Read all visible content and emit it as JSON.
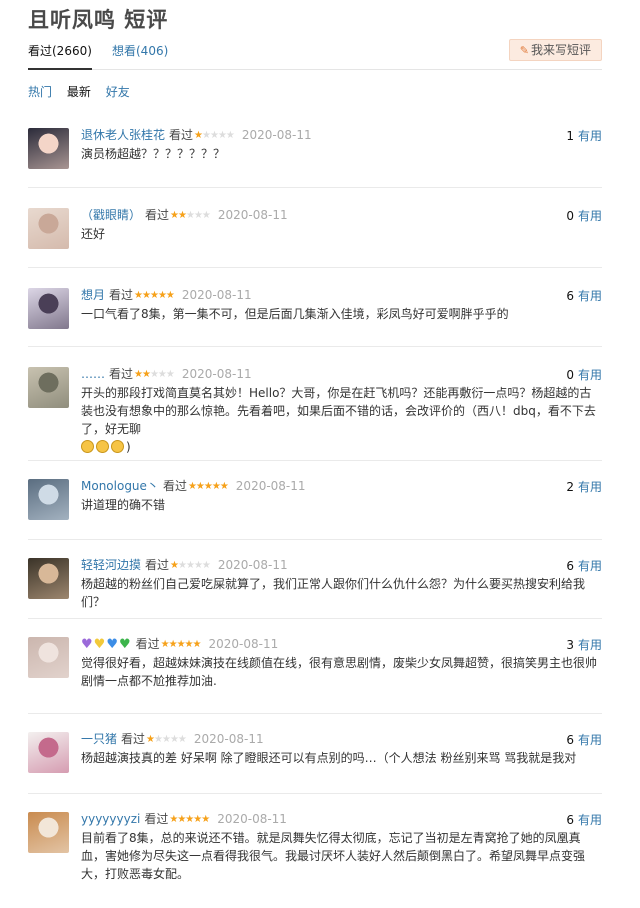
{
  "page": {
    "title": "且听凤鸣 短评"
  },
  "tabs": {
    "watched": "看过(2660)",
    "want": "想看(406)"
  },
  "write_button": "我来写短评",
  "filters": [
    "热门",
    "最新",
    "好友"
  ],
  "vote_label": "有用",
  "colors": {
    "link": "#3377aa",
    "star": "#f6a11a",
    "button_bg": "#fcebe0"
  },
  "comments": [
    {
      "user": "退休老人张桂花",
      "status": "看过",
      "rating": 1,
      "date": "2020-08-11",
      "votes": "1",
      "text": "演员杨超越？？？？？？？"
    },
    {
      "user": "（戳眼睛）",
      "status": "看过",
      "rating": 2,
      "date": "2020-08-11",
      "votes": "0",
      "text": "还好"
    },
    {
      "user": "想月",
      "status": "看过",
      "rating": 5,
      "date": "2020-08-11",
      "votes": "6",
      "text": "一口气看了8集，第一集不可，但是后面几集渐入佳境，彩凤鸟好可爱啊胖乎乎的"
    },
    {
      "user": "……",
      "status": "看过",
      "rating": 2,
      "date": "2020-08-11",
      "votes": "0",
      "text": "开头的那段打戏简直莫名其妙！Hello？大哥，你是在赶飞机吗？还能再敷衍一点吗？杨超越的古装也没有想象中的那么惊艳。先看着吧，如果后面不错的话，会改评价的（西八！dbq，看不下去了，好无聊",
      "text_tail": ")"
    },
    {
      "user": "Monologue丶",
      "status": "看过",
      "rating": 5,
      "date": "2020-08-11",
      "votes": "2",
      "text": "讲道理的确不错"
    },
    {
      "user": "轻轻河边摸",
      "status": "看过",
      "rating": 1,
      "date": "2020-08-11",
      "votes": "6",
      "text": "杨超越的粉丝们自己爱吃屎就算了，我们正常人跟你们什么仇什么怨？为什么要买热搜安利给我们？"
    },
    {
      "user": "💜💛💙💚",
      "status": "看过",
      "rating": 5,
      "date": "2020-08-11",
      "votes": "3",
      "text": "觉得很好看，超越妹妹演技在线颜值在线，很有意思剧情，废柴少女凤舞超赞，很搞笑男主也很帅剧情一点都不尬推荐加油."
    },
    {
      "user": "一只猪",
      "status": "看过",
      "rating": 1,
      "date": "2020-08-11",
      "votes": "6",
      "text": "杨超越演技真的差 好呆啊 除了瞪眼还可以有点别的吗…（个人想法 粉丝别来骂 骂我就是我对"
    },
    {
      "user": "yyyyyyyzi",
      "status": "看过",
      "rating": 5,
      "date": "2020-08-11",
      "votes": "6",
      "text": "目前看了8集，总的来说还不错。就是凤舞失忆得太彻底，忘记了当初是左青窝抢了她的凤凰真血，害她修为尽失这一点看得我很气。我最讨厌坏人装好人然后颠倒黑白了。希望凤舞早点变强大，打败恶毒女配。"
    }
  ]
}
